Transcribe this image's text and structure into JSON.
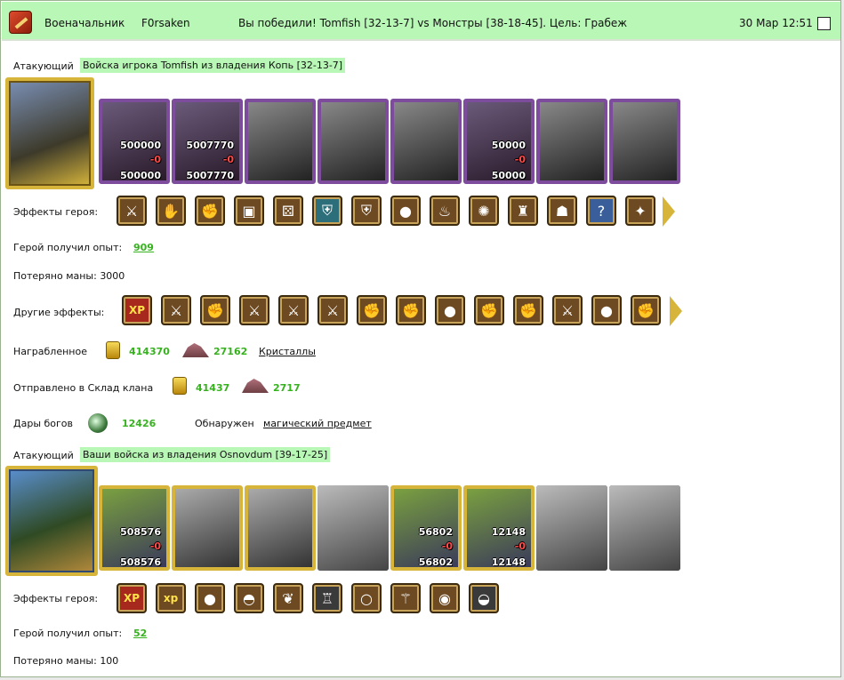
{
  "header": {
    "title": "Военачальник",
    "player": "F0rsaken",
    "result": "Вы победили! Tomfish [32-13-7] vs Монстры [38-18-45]. Цель: Грабеж",
    "datetime": "30 Мар 12:51"
  },
  "side1": {
    "role_label": "Атакующий",
    "army_label": "Войска игрока Tomfish из владения Копь [32-13-7]",
    "units": [
      {
        "style": "purple",
        "n1": "500000",
        "d": "-0",
        "n2": "500000"
      },
      {
        "style": "purple",
        "n1": "5007770",
        "d": "-0",
        "n2": "5007770"
      },
      {
        "style": "purple",
        "n1": "",
        "d": "",
        "n2": ""
      },
      {
        "style": "purple",
        "n1": "",
        "d": "",
        "n2": ""
      },
      {
        "style": "purple",
        "n1": "",
        "d": "",
        "n2": ""
      },
      {
        "style": "purple",
        "n1": "50000",
        "d": "-0",
        "n2": "50000"
      },
      {
        "style": "purple",
        "n1": "",
        "d": "",
        "n2": ""
      },
      {
        "style": "purple",
        "n1": "",
        "d": "",
        "n2": ""
      }
    ],
    "hero_effects_label": "Эффекты героя:",
    "hero_effects": [
      "sword-icon",
      "handshake-icon",
      "fist-icon",
      "chest-icon",
      "dice-icon",
      "shield-icon",
      "shield-hand-icon",
      "gold-bag-icon",
      "torch-icon",
      "sun-icon",
      "armor-icon",
      "mask-icon",
      "question-icon",
      "star-icon"
    ],
    "xp_label": "Герой получил опыт:",
    "xp_value": "909",
    "mana_label": "Потеряно маны: 3000",
    "other_effects_label": "Другие эффекты:",
    "other_effects": [
      "xp-icon",
      "sword-icon",
      "fist-icon",
      "sword-icon",
      "sword-icon",
      "sword-icon",
      "fist-icon",
      "fist-icon",
      "gold-bag-icon",
      "fist-icon",
      "fist-icon",
      "sword-icon",
      "gold-bag-icon",
      "fist-icon"
    ],
    "loot_label": "Награбленное",
    "loot_gold": "414370",
    "loot_crystals": "27162",
    "loot_crystals_link": "Кристаллы",
    "clan_label": "Отправлено в Склад клана",
    "clan_gold": "41437",
    "clan_crystals": "2717",
    "gifts_label": "Дары богов",
    "gifts_value": "12426",
    "found_label": "Обнаружен",
    "found_link": "магический предмет"
  },
  "side2": {
    "role_label": "Атакующий",
    "army_label": "Ваши войска из владения Osnovdum [39-17-25]",
    "units": [
      {
        "style": "gold",
        "n1": "508576",
        "d": "-0",
        "n2": "508576"
      },
      {
        "style": "gold",
        "n1": "",
        "d": "",
        "n2": ""
      },
      {
        "style": "gold",
        "n1": "",
        "d": "",
        "n2": ""
      },
      {
        "style": "plain",
        "n1": "",
        "d": "",
        "n2": ""
      },
      {
        "style": "gold",
        "n1": "56802",
        "d": "-0",
        "n2": "56802"
      },
      {
        "style": "gold",
        "n1": "12148",
        "d": "-0",
        "n2": "12148"
      },
      {
        "style": "plain",
        "n1": "",
        "d": "",
        "n2": ""
      },
      {
        "style": "plain",
        "n1": "",
        "d": "",
        "n2": ""
      }
    ],
    "hero_effects_label": "Эффекты героя:",
    "hero_effects": [
      "xp-icon",
      "xp-scroll-icon",
      "gold-bag-icon",
      "helmet-icon",
      "wings-icon",
      "chainmail-icon",
      "ring-icon",
      "staff-icon",
      "orb-icon",
      "helm-dark-icon"
    ],
    "xp_label": "Герой получил опыт:",
    "xp_value": "52",
    "mana_label": "Потеряно маны: 100"
  },
  "colors": {
    "header_bg": "#b8f7b5",
    "highlight_bg": "#b8f7b5",
    "number_green": "#37b21f",
    "purple_frame": "#7d4c9c",
    "gold_frame": "#d7b53b"
  }
}
